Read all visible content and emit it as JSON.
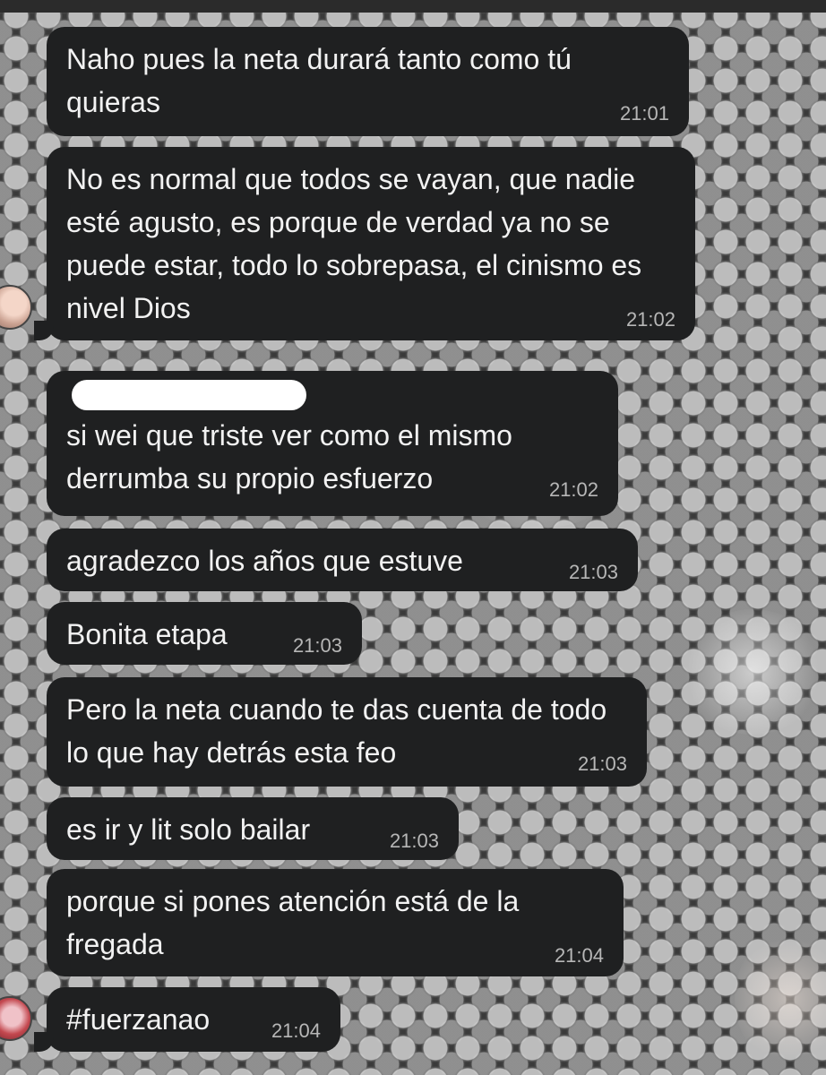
{
  "messages": [
    {
      "text": "Naho pues la neta durará tanto como tú quieras",
      "time": "21:01"
    },
    {
      "text": "No es normal que todos se vayan, que nadie esté agusto, es porque de verdad ya no se puede estar, todo lo sobrepasa, el cinismo es nivel Dios",
      "time": "21:02"
    },
    {
      "text": "si wei que triste ver como el mismo derrumba su propio esfuerzo",
      "time": "21:02"
    },
    {
      "text": "agradezco los años que estuve",
      "time": "21:03"
    },
    {
      "text": "Bonita etapa",
      "time": "21:03"
    },
    {
      "text": "Pero la neta cuando te das cuenta de todo lo que hay detrás esta feo",
      "time": "21:03"
    },
    {
      "text": "es ir y lit solo bailar",
      "time": "21:03"
    },
    {
      "text": "porque si pones atención está de la fregada",
      "time": "21:04"
    },
    {
      "text": "#fuerzanao",
      "time": "21:04"
    }
  ]
}
